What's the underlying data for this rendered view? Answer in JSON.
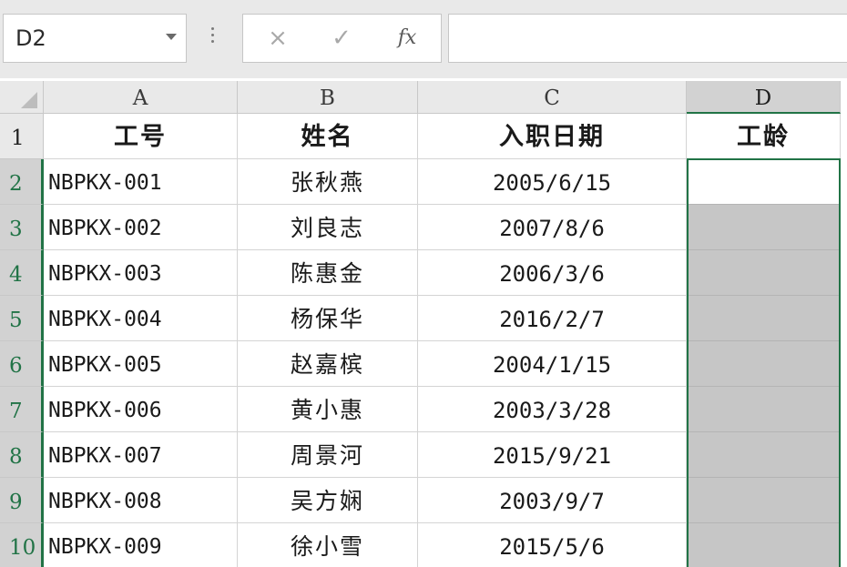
{
  "formula_bar": {
    "name_box": "D2",
    "cancel_icon": "×",
    "enter_icon": "✓",
    "function_icon": "fx",
    "formula": ""
  },
  "sheet": {
    "columns": [
      "A",
      "B",
      "C",
      "D"
    ],
    "selected_column": "D",
    "rows": [
      "1",
      "2",
      "3",
      "4",
      "5",
      "6",
      "7",
      "8",
      "9",
      "10"
    ],
    "selected_rows": [
      "2",
      "3",
      "4",
      "5",
      "6",
      "7",
      "8",
      "9",
      "10"
    ],
    "headers": [
      "工号",
      "姓名",
      "入职日期",
      "工龄"
    ],
    "data": [
      {
        "id": "NBPKX-001",
        "name": "张秋燕",
        "date": "2005/6/15",
        "tenure": ""
      },
      {
        "id": "NBPKX-002",
        "name": "刘良志",
        "date": "2007/8/6",
        "tenure": ""
      },
      {
        "id": "NBPKX-003",
        "name": "陈惠金",
        "date": "2006/3/6",
        "tenure": ""
      },
      {
        "id": "NBPKX-004",
        "name": "杨保华",
        "date": "2016/2/7",
        "tenure": ""
      },
      {
        "id": "NBPKX-005",
        "name": "赵嘉槟",
        "date": "2004/1/15",
        "tenure": ""
      },
      {
        "id": "NBPKX-006",
        "name": "黄小惠",
        "date": "2003/3/28",
        "tenure": ""
      },
      {
        "id": "NBPKX-007",
        "name": "周景河",
        "date": "2015/9/21",
        "tenure": ""
      },
      {
        "id": "NBPKX-008",
        "name": "吴方娴",
        "date": "2003/9/7",
        "tenure": ""
      },
      {
        "id": "NBPKX-009",
        "name": "徐小雪",
        "date": "2015/5/6",
        "tenure": ""
      }
    ]
  },
  "colors": {
    "selection_accent": "#217346",
    "selected_fill": "#c6c6c6",
    "header_bg": "#e9e9e9"
  }
}
